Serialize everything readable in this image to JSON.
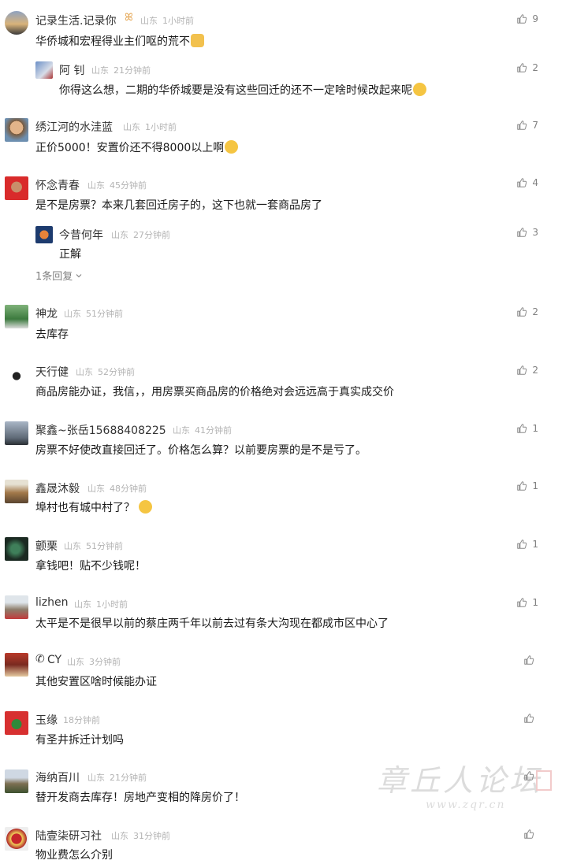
{
  "comments": [
    {
      "user": "记录生活.记录你",
      "location": "山东",
      "time": "1小时前",
      "content": "华侨城和宏程得业主们呕的荒不",
      "likes": "9"
    },
    {
      "user": "阿 钊",
      "location": "山东",
      "time": "21分钟前",
      "content": "你得这么想，二期的华侨城要是没有这些回迁的还不一定啥时候改起来呢",
      "likes": "2"
    },
    {
      "user": "绣江河的水洼蓝",
      "location": "山东",
      "time": "1小时前",
      "content": "正价5000！安置价还不得8000以上啊",
      "likes": "7"
    },
    {
      "user": "怀念青春",
      "location": "山东",
      "time": "45分钟前",
      "content": "是不是房票？本来几套回迁房子的，这下也就一套商品房了",
      "likes": "4"
    },
    {
      "user": "今昔何年",
      "location": "山东",
      "time": "27分钟前",
      "content": "正解",
      "likes": "3"
    },
    {
      "user": "神龙",
      "location": "山东",
      "time": "51分钟前",
      "content": "去库存",
      "likes": "2"
    },
    {
      "user": "天行健",
      "location": "山东",
      "time": "52分钟前",
      "content": "商品房能办证，我信，，用房票买商品房的价格绝对会远远高于真实成交价",
      "likes": "2"
    },
    {
      "user": "聚鑫~张岳15688408225",
      "location": "山东",
      "time": "41分钟前",
      "content": "房票不好使改直接回迁了。价格怎么算？以前要房票的是不是亏了。",
      "likes": "1"
    },
    {
      "user": "鑫晟沐毅",
      "location": "山东",
      "time": "48分钟前",
      "content": "埠村也有城中村了？",
      "likes": "1"
    },
    {
      "user": "颤栗",
      "location": "山东",
      "time": "51分钟前",
      "content": "拿钱吧！贴不少钱呢！",
      "likes": "1"
    },
    {
      "user": "lizhen",
      "location": "山东",
      "time": "1小时前",
      "content": "太平是不是很早以前的蔡庄两千年以前去过有条大沟现在都成市区中心了",
      "likes": "1"
    },
    {
      "user": "CY",
      "location": "山东",
      "time": "3分钟前",
      "content": "其他安置区啥时候能办证",
      "likes": ""
    },
    {
      "user": "玉缘",
      "location": "",
      "time": "18分钟前",
      "content": "有圣井拆迁计划吗",
      "likes": ""
    },
    {
      "user": "海纳百川",
      "location": "山东",
      "time": "21分钟前",
      "content": "替开发商去库存！房地产变相的降房价了！",
      "likes": ""
    },
    {
      "user": "陆壹柒研习社",
      "location": "山东",
      "time": "31分钟前",
      "content": "物业费怎么介别",
      "likes": ""
    }
  ],
  "more_replies": "1条回复",
  "watermark_text": "章丘人论坛",
  "watermark_url": "www.zqr.cn",
  "icons": {
    "like": "thumbs-up-icon",
    "chevron": "chevron-down-icon"
  }
}
